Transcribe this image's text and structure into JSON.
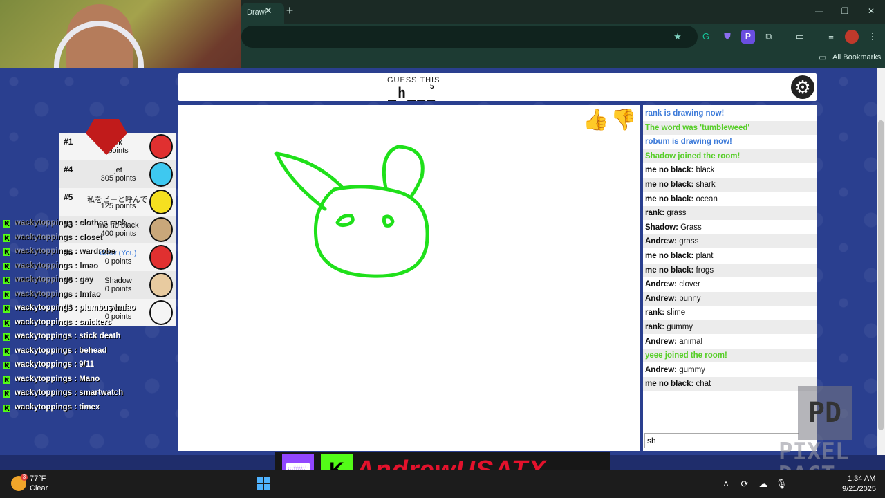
{
  "browser": {
    "tab_title": "Drawi",
    "tab_close": "✕",
    "new_tab": "+",
    "bookmarks_label": "All Bookmarks"
  },
  "game": {
    "guess_label": "GUESS THIS",
    "word_hint": "_h___",
    "word_length": "5"
  },
  "players": [
    {
      "rank": "#1",
      "name": "nk",
      "points": "points",
      "you": false
    },
    {
      "rank": "#4",
      "name": "jet",
      "points": "305 points",
      "you": false
    },
    {
      "rank": "#5",
      "name": "私をビーと呼んでくださ",
      "points": "125 points",
      "you": false
    },
    {
      "rank": "#3",
      "name": "me no black",
      "points": "400 points",
      "you": false
    },
    {
      "rank": "#6",
      "name": "drew (You)",
      "points": "0 points",
      "you": true
    },
    {
      "rank": "#6",
      "name": "Shadow",
      "points": "0 points",
      "you": false
    },
    {
      "rank": "#6",
      "name": "yeee",
      "points": "0 points",
      "you": false
    }
  ],
  "chat": {
    "messages": [
      {
        "type": "sys-blue",
        "user": "",
        "text": "rank is drawing now!"
      },
      {
        "type": "sys-green",
        "user": "",
        "text": "The word was 'tumbleweed'"
      },
      {
        "type": "sys-blue",
        "user": "",
        "text": "robum is drawing now!"
      },
      {
        "type": "sys-green",
        "user": "",
        "text": "Shadow joined the room!"
      },
      {
        "type": "msg",
        "user": "me no black:",
        "text": " black"
      },
      {
        "type": "msg",
        "user": "me no black:",
        "text": " shark"
      },
      {
        "type": "msg",
        "user": "me no black:",
        "text": " ocean"
      },
      {
        "type": "msg",
        "user": "rank:",
        "text": " grass"
      },
      {
        "type": "msg",
        "user": "Shadow:",
        "text": " Grass"
      },
      {
        "type": "msg",
        "user": "Andrew:",
        "text": " grass"
      },
      {
        "type": "msg",
        "user": "me no black:",
        "text": " plant"
      },
      {
        "type": "msg",
        "user": "me no black:",
        "text": " frogs"
      },
      {
        "type": "msg",
        "user": "Andrew:",
        "text": " clover"
      },
      {
        "type": "msg",
        "user": "Andrew:",
        "text": " bunny"
      },
      {
        "type": "msg",
        "user": "rank:",
        "text": " slime"
      },
      {
        "type": "msg",
        "user": "rank:",
        "text": " gummy"
      },
      {
        "type": "msg",
        "user": "Andrew:",
        "text": " animal"
      },
      {
        "type": "sys-green",
        "user": "",
        "text": "yeee joined the room!"
      },
      {
        "type": "msg",
        "user": "Andrew:",
        "text": " gummy"
      },
      {
        "type": "msg",
        "user": "me no black:",
        "text": " chat"
      }
    ],
    "input_value": "sh"
  },
  "stream_chat": [
    {
      "text": "wackytoppings : clothes rack",
      "faded": true
    },
    {
      "text": "wackytoppings : closet",
      "faded": true
    },
    {
      "text": "wackytoppings : wardrobe",
      "faded": true
    },
    {
      "text": "wackytoppings : lmao",
      "faded": true
    },
    {
      "text": "wackytoppings : gay",
      "faded": true
    },
    {
      "text": "wackytoppings : lmfao",
      "faded": true
    },
    {
      "text": "wackytoppings : plumbus lmfao",
      "faded": false
    },
    {
      "text": "wackytoppings : snickers",
      "faded": false
    },
    {
      "text": "wackytoppings : stick death",
      "faded": false
    },
    {
      "text": "wackytoppings : behead",
      "faded": false
    },
    {
      "text": "wackytoppings : 9/11",
      "faded": false
    },
    {
      "text": "wackytoppings : Mano",
      "faded": false
    },
    {
      "text": "wackytoppings : smartwatch",
      "faded": false
    },
    {
      "text": "wackytoppings : timex",
      "faded": false
    }
  ],
  "banner": {
    "name": "AndrewUSATX",
    "twitch_icon": "twitch-icon",
    "kick_icon": "kick-icon"
  },
  "watermark": {
    "pd": "PD",
    "line1": "PIXEL",
    "line2": "DACT"
  },
  "taskbar": {
    "weather_badge": "3",
    "temperature": "77°F",
    "condition": "Clear",
    "time": "1:34 AM",
    "date": "9/21/2025"
  },
  "colors": {
    "drawing_stroke": "#1fe01a",
    "player_avatars": [
      "#e03030",
      "#3ec8f0",
      "#f5e020",
      "#c9a77a",
      "#e03030",
      "#e8cba0",
      "#f4f4f4"
    ]
  }
}
